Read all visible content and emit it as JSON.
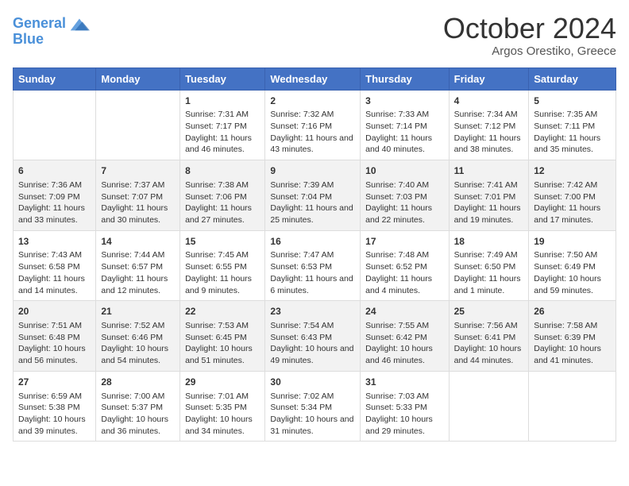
{
  "header": {
    "logo_line1": "General",
    "logo_line2": "Blue",
    "title": "October 2024",
    "subtitle": "Argos Orestiko, Greece"
  },
  "days_of_week": [
    "Sunday",
    "Monday",
    "Tuesday",
    "Wednesday",
    "Thursday",
    "Friday",
    "Saturday"
  ],
  "weeks": [
    [
      {
        "day": "",
        "content": ""
      },
      {
        "day": "",
        "content": ""
      },
      {
        "day": "1",
        "content": "Sunrise: 7:31 AM\nSunset: 7:17 PM\nDaylight: 11 hours and 46 minutes."
      },
      {
        "day": "2",
        "content": "Sunrise: 7:32 AM\nSunset: 7:16 PM\nDaylight: 11 hours and 43 minutes."
      },
      {
        "day": "3",
        "content": "Sunrise: 7:33 AM\nSunset: 7:14 PM\nDaylight: 11 hours and 40 minutes."
      },
      {
        "day": "4",
        "content": "Sunrise: 7:34 AM\nSunset: 7:12 PM\nDaylight: 11 hours and 38 minutes."
      },
      {
        "day": "5",
        "content": "Sunrise: 7:35 AM\nSunset: 7:11 PM\nDaylight: 11 hours and 35 minutes."
      }
    ],
    [
      {
        "day": "6",
        "content": "Sunrise: 7:36 AM\nSunset: 7:09 PM\nDaylight: 11 hours and 33 minutes."
      },
      {
        "day": "7",
        "content": "Sunrise: 7:37 AM\nSunset: 7:07 PM\nDaylight: 11 hours and 30 minutes."
      },
      {
        "day": "8",
        "content": "Sunrise: 7:38 AM\nSunset: 7:06 PM\nDaylight: 11 hours and 27 minutes."
      },
      {
        "day": "9",
        "content": "Sunrise: 7:39 AM\nSunset: 7:04 PM\nDaylight: 11 hours and 25 minutes."
      },
      {
        "day": "10",
        "content": "Sunrise: 7:40 AM\nSunset: 7:03 PM\nDaylight: 11 hours and 22 minutes."
      },
      {
        "day": "11",
        "content": "Sunrise: 7:41 AM\nSunset: 7:01 PM\nDaylight: 11 hours and 19 minutes."
      },
      {
        "day": "12",
        "content": "Sunrise: 7:42 AM\nSunset: 7:00 PM\nDaylight: 11 hours and 17 minutes."
      }
    ],
    [
      {
        "day": "13",
        "content": "Sunrise: 7:43 AM\nSunset: 6:58 PM\nDaylight: 11 hours and 14 minutes."
      },
      {
        "day": "14",
        "content": "Sunrise: 7:44 AM\nSunset: 6:57 PM\nDaylight: 11 hours and 12 minutes."
      },
      {
        "day": "15",
        "content": "Sunrise: 7:45 AM\nSunset: 6:55 PM\nDaylight: 11 hours and 9 minutes."
      },
      {
        "day": "16",
        "content": "Sunrise: 7:47 AM\nSunset: 6:53 PM\nDaylight: 11 hours and 6 minutes."
      },
      {
        "day": "17",
        "content": "Sunrise: 7:48 AM\nSunset: 6:52 PM\nDaylight: 11 hours and 4 minutes."
      },
      {
        "day": "18",
        "content": "Sunrise: 7:49 AM\nSunset: 6:50 PM\nDaylight: 11 hours and 1 minute."
      },
      {
        "day": "19",
        "content": "Sunrise: 7:50 AM\nSunset: 6:49 PM\nDaylight: 10 hours and 59 minutes."
      }
    ],
    [
      {
        "day": "20",
        "content": "Sunrise: 7:51 AM\nSunset: 6:48 PM\nDaylight: 10 hours and 56 minutes."
      },
      {
        "day": "21",
        "content": "Sunrise: 7:52 AM\nSunset: 6:46 PM\nDaylight: 10 hours and 54 minutes."
      },
      {
        "day": "22",
        "content": "Sunrise: 7:53 AM\nSunset: 6:45 PM\nDaylight: 10 hours and 51 minutes."
      },
      {
        "day": "23",
        "content": "Sunrise: 7:54 AM\nSunset: 6:43 PM\nDaylight: 10 hours and 49 minutes."
      },
      {
        "day": "24",
        "content": "Sunrise: 7:55 AM\nSunset: 6:42 PM\nDaylight: 10 hours and 46 minutes."
      },
      {
        "day": "25",
        "content": "Sunrise: 7:56 AM\nSunset: 6:41 PM\nDaylight: 10 hours and 44 minutes."
      },
      {
        "day": "26",
        "content": "Sunrise: 7:58 AM\nSunset: 6:39 PM\nDaylight: 10 hours and 41 minutes."
      }
    ],
    [
      {
        "day": "27",
        "content": "Sunrise: 6:59 AM\nSunset: 5:38 PM\nDaylight: 10 hours and 39 minutes."
      },
      {
        "day": "28",
        "content": "Sunrise: 7:00 AM\nSunset: 5:37 PM\nDaylight: 10 hours and 36 minutes."
      },
      {
        "day": "29",
        "content": "Sunrise: 7:01 AM\nSunset: 5:35 PM\nDaylight: 10 hours and 34 minutes."
      },
      {
        "day": "30",
        "content": "Sunrise: 7:02 AM\nSunset: 5:34 PM\nDaylight: 10 hours and 31 minutes."
      },
      {
        "day": "31",
        "content": "Sunrise: 7:03 AM\nSunset: 5:33 PM\nDaylight: 10 hours and 29 minutes."
      },
      {
        "day": "",
        "content": ""
      },
      {
        "day": "",
        "content": ""
      }
    ]
  ]
}
